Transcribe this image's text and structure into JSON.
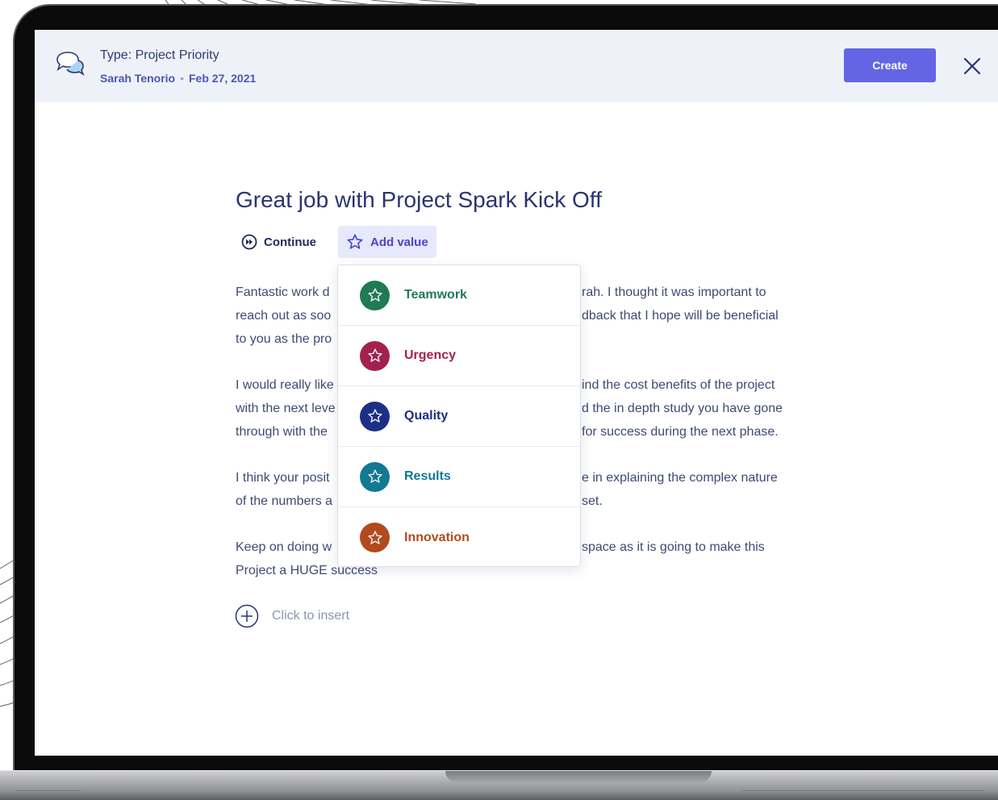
{
  "header": {
    "doc_type": "Type: Project Priority",
    "author": "Sarah Tenorio",
    "date": "Feb 27, 2021",
    "create_label": "Create"
  },
  "document": {
    "title": "Great job with Project Spark Kick Off",
    "continue_label": "Continue",
    "add_value_label": "Add value",
    "paragraphs": [
      [
        "Fantastic work d",
        "rah. I thought it was important to",
        "reach out as soo",
        "dback that I hope will be beneficial",
        "to you as the pro"
      ],
      [
        "I would really like",
        "ind the cost benefits of the project",
        "with the next leve",
        "d the in depth study you have gone",
        "through with the",
        "for success during the next phase."
      ],
      [
        "I think your posit",
        "e in explaining the complex nature",
        "of the numbers a",
        "set."
      ],
      [
        "Keep on doing w",
        "space as it is going to make this",
        "Project a HUGE success"
      ]
    ],
    "insert_label": "Click to insert"
  },
  "values_menu": {
    "items": [
      {
        "label": "Teamwork",
        "color": "#1f7a55"
      },
      {
        "label": "Urgency",
        "color": "#a3204f"
      },
      {
        "label": "Quality",
        "color": "#1c2f87"
      },
      {
        "label": "Results",
        "color": "#137891"
      },
      {
        "label": "Innovation",
        "color": "#b34a1e"
      }
    ]
  },
  "icons": [
    "chat-bubbles-icon",
    "close-icon",
    "fast-forward-icon",
    "star-icon",
    "plus-circle-icon"
  ]
}
